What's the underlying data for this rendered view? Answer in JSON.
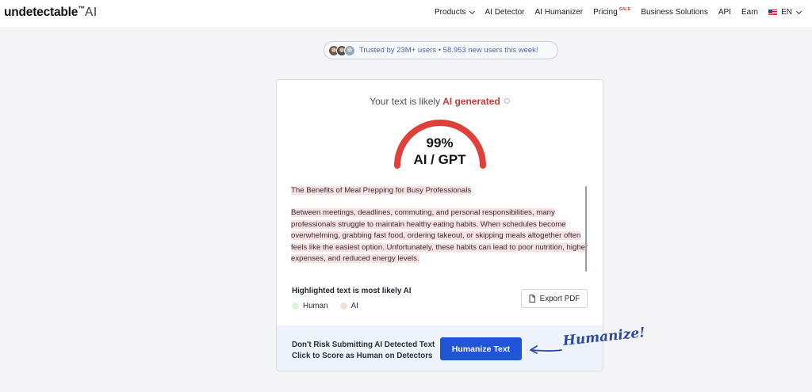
{
  "brand": {
    "name": "undetectable",
    "tm": "™",
    "suffix": "AI"
  },
  "nav": {
    "products": "Products",
    "ai_detector": "AI Detector",
    "ai_humanizer": "AI Humanizer",
    "pricing": "Pricing",
    "sale_badge": "SALE",
    "business": "Business Solutions",
    "api": "API",
    "earn": "Earn",
    "language": "EN"
  },
  "trust": {
    "text": "Trusted by 23M+ users • 58.953 new users this week!"
  },
  "result": {
    "prefix": "Your text is likely",
    "verdict": "AI generated",
    "gauge_percent_value": 99,
    "percent": "99%",
    "label": "AI / GPT"
  },
  "analyzed_text": {
    "title": "The Benefits of Meal Prepping for Busy Professionals",
    "body": " Between meetings, deadlines, commuting, and personal responsibilities, many professionals struggle to maintain healthy eating habits.  When schedules become overwhelming, grabbing fast food, ordering takeout, or skipping meals altogether often feels like the easiest option.  Unfortunately, these habits can lead to poor nutrition, higher expenses, and reduced energy levels."
  },
  "legend": {
    "title": "Highlighted text is most likely AI",
    "human": "Human",
    "ai": "AI"
  },
  "export": {
    "label": "Export PDF"
  },
  "cta": {
    "line1": "Don't Risk Submitting AI Detected Text",
    "line2": "Click to Score as Human on Detectors",
    "button": "Humanize Text",
    "annotation": "Humanize!"
  },
  "colors": {
    "accent": "#1f55d6",
    "ai_red": "#e0403a",
    "ai_highlight": "#fbe1e1",
    "human_highlight": "#d9f1de",
    "trust_blue": "#4a66b7"
  },
  "icons": [
    "chevron-down-icon",
    "us-flag-icon",
    "info-icon",
    "document-icon",
    "arrow-icon"
  ]
}
